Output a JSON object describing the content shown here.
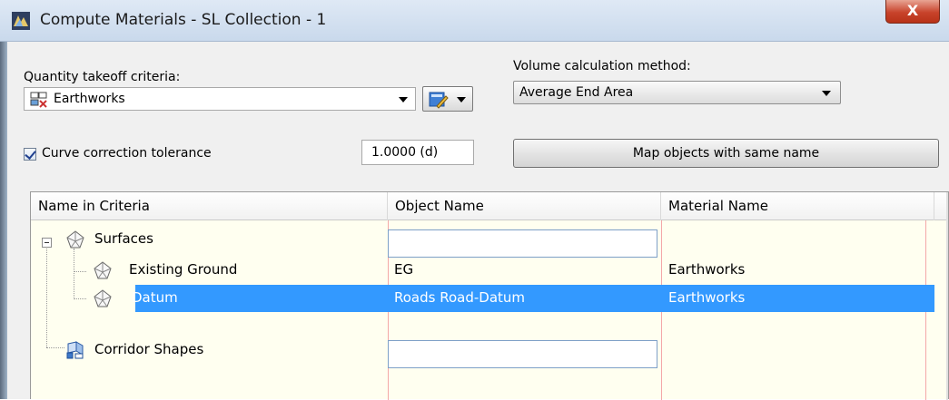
{
  "window": {
    "title": "Compute Materials - SL Collection - 1",
    "close_glyph": "X"
  },
  "criteria": {
    "label": "Quantity takeoff criteria:",
    "value": "Earthworks"
  },
  "volume": {
    "label": "Volume calculation method:",
    "value": "Average End Area"
  },
  "curve": {
    "checked": true,
    "label": "Curve correction tolerance",
    "value": "1.0000 (d)"
  },
  "map_button": "Map objects with same name",
  "grid": {
    "columns": [
      "Name in Criteria",
      "Object Name",
      "Material Name"
    ],
    "rows": [
      {
        "name": "Surfaces",
        "object": "",
        "material": "",
        "icon": "surface-icon",
        "level": 0
      },
      {
        "name": "Existing Ground",
        "object": "EG",
        "material": "Earthworks",
        "icon": "surface-icon",
        "level": 1
      },
      {
        "name": "Datum",
        "object": "Roads Road-Datum",
        "material": "Earthworks",
        "icon": "surface-icon",
        "level": 1,
        "selected": true
      },
      {
        "name": "Corridor Shapes",
        "object": "",
        "material": "",
        "icon": "corridor-shape-icon",
        "level": 0
      }
    ]
  },
  "colors": {
    "selection": "#3399ff",
    "grid_background": "#fffff0",
    "close_button": "#c8432b"
  }
}
